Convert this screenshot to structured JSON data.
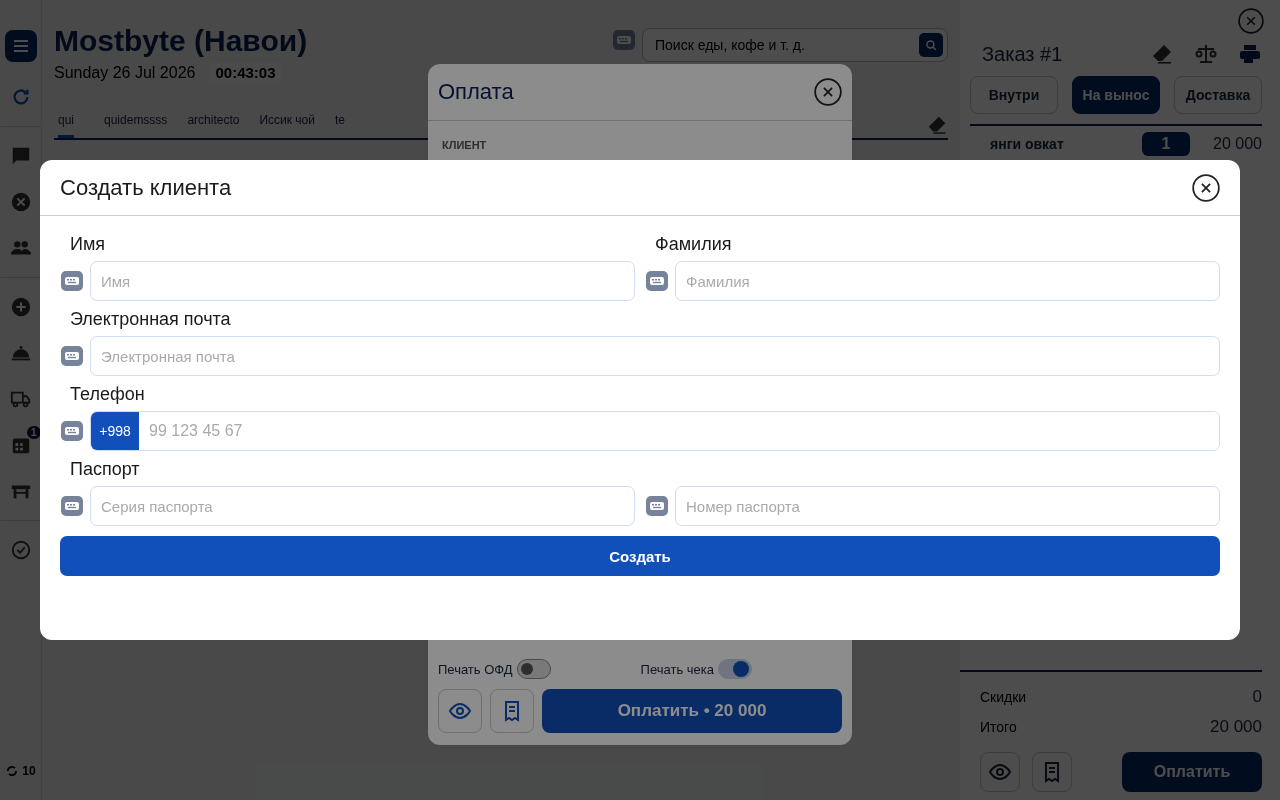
{
  "app": {
    "title": "Mostbyte (Навои)",
    "date": "Sunday 26 Jul 2026",
    "clock": "00:43:03",
    "search": {
      "placeholder": "Поиск еды, кофе и т. д."
    },
    "sidebar_badge": "1",
    "sync_count": "10"
  },
  "category_tabs": [
    {
      "label": "qui",
      "selected": true
    },
    {
      "label": "quidemssss",
      "selected": false
    },
    {
      "label": "architecto",
      "selected": false
    },
    {
      "label": "Иссик чой",
      "selected": false
    },
    {
      "label": "te",
      "selected": false
    }
  ],
  "order": {
    "title": "Заказ #1",
    "types": [
      {
        "label": "Внутри",
        "selected": false
      },
      {
        "label": "На вынос",
        "selected": true
      },
      {
        "label": "Доставка",
        "selected": false
      }
    ],
    "items": [
      {
        "name": "янги овкат",
        "qty": "1",
        "price": "20 000"
      }
    ],
    "totals": [
      {
        "label": "Скидки",
        "value": "0"
      },
      {
        "label": "Итого",
        "value": "20 000"
      }
    ],
    "pay_button": "Оплатить"
  },
  "payment_dialog": {
    "title": "Оплата",
    "client_label": "КЛИЕНТ",
    "toggles": [
      {
        "label": "Печать ОФД",
        "on": false
      },
      {
        "label": "Печать чека",
        "on": true
      }
    ],
    "pay_button": "Оплатить • 20 000"
  },
  "client_dialog": {
    "title": "Создать клиента",
    "groups": [
      {
        "label": "Имя",
        "wide": false,
        "fields": [
          {
            "placeholder": "Имя"
          }
        ]
      },
      {
        "label": "Фамилия",
        "wide": false,
        "fields": [
          {
            "placeholder": "Фамилия"
          }
        ]
      },
      {
        "label": "Электронная почта",
        "wide": true,
        "fields": [
          {
            "placeholder": "Электронная почта"
          }
        ]
      },
      {
        "label": "Телефон",
        "wide": true,
        "fields": [
          {
            "prefix": "+998",
            "placeholder": "99 123 45 67"
          }
        ]
      },
      {
        "label": "Паспорт",
        "wide": true,
        "fields": [
          {
            "placeholder": "Серия паспорта"
          },
          {
            "placeholder": "Номер паспорта"
          }
        ]
      }
    ],
    "submit": "Создать"
  }
}
